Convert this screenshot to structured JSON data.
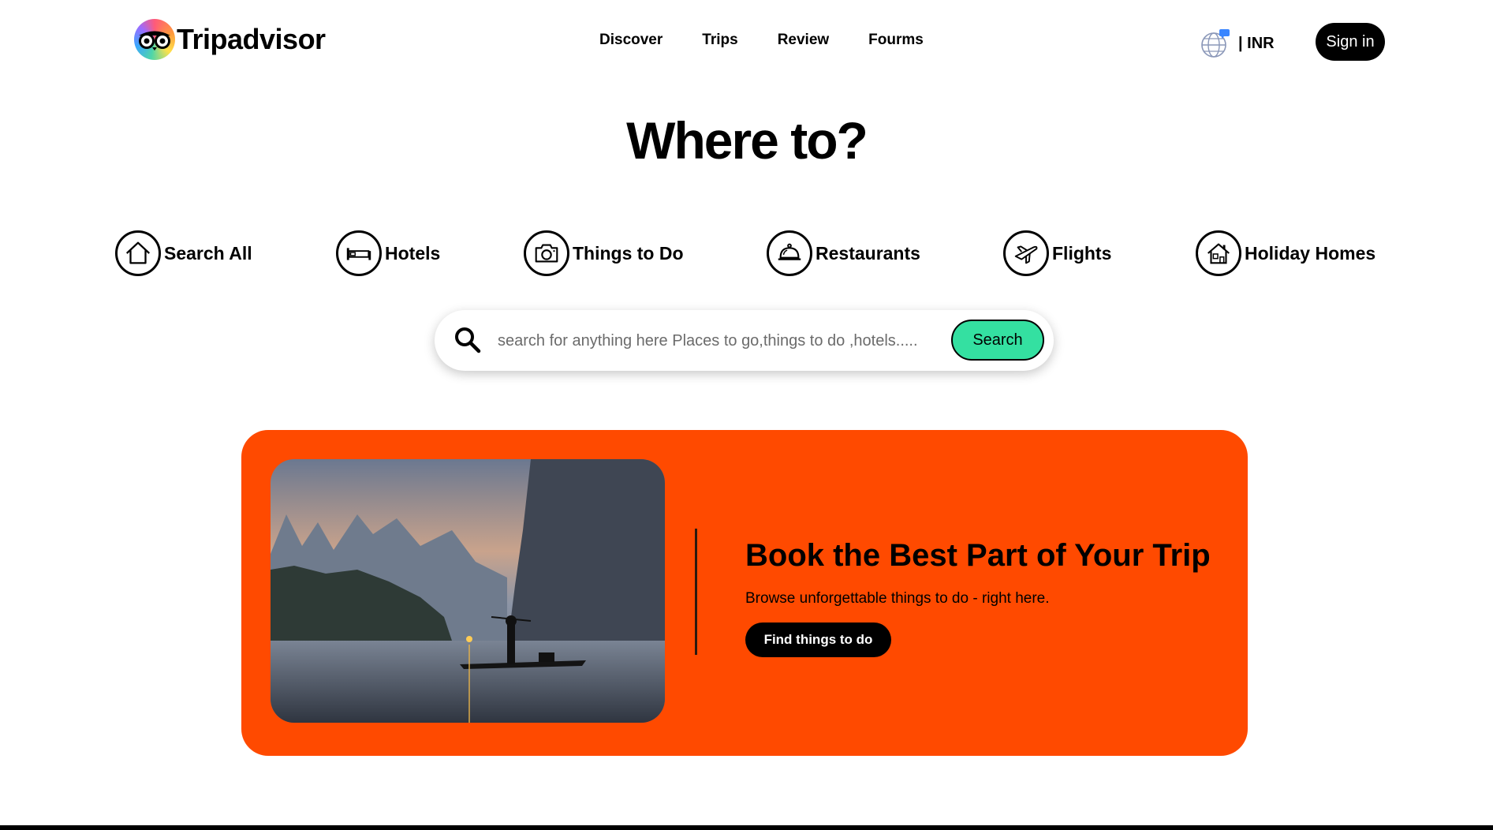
{
  "brand": {
    "name": "Tripadvisor"
  },
  "nav": {
    "items": [
      "Discover",
      "Trips",
      "Review",
      "Fourms"
    ]
  },
  "currency": {
    "label": "| INR"
  },
  "auth": {
    "signin_label": "Sign in"
  },
  "hero": {
    "title": "Where to?"
  },
  "categories": [
    {
      "label": "Search All",
      "icon": "home-icon"
    },
    {
      "label": "Hotels",
      "icon": "bed-icon"
    },
    {
      "label": "Things to Do",
      "icon": "camera-icon"
    },
    {
      "label": "Restaurants",
      "icon": "cloche-icon"
    },
    {
      "label": "Flights",
      "icon": "plane-icon"
    },
    {
      "label": "Holiday Homes",
      "icon": "house-icon"
    }
  ],
  "search": {
    "placeholder": "search for anything here Places to go,things to do ,hotels.....",
    "button_label": "Search"
  },
  "promo": {
    "title": "Book the Best Part of Your Trip",
    "subtitle": "Browse unforgettable things to do - right here.",
    "button_label": "Find things to do"
  },
  "colors": {
    "accent_green": "#34e0a1",
    "promo_orange": "#ff4a00",
    "text_black": "#000000"
  }
}
